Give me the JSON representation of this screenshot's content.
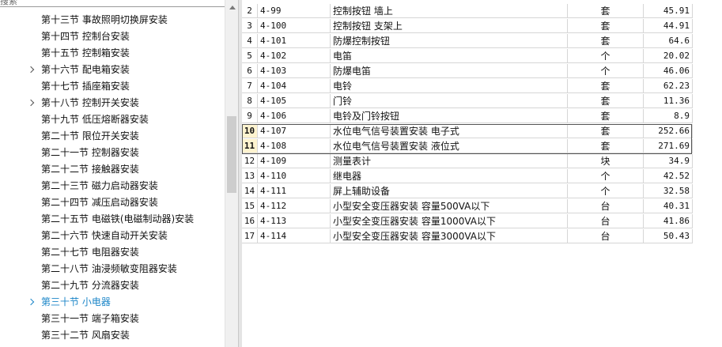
{
  "tree": {
    "search_partial": "搜索",
    "items": [
      {
        "label": "第十三节  事故照明切换屏安装",
        "expandable": false
      },
      {
        "label": "第十四节  控制台安装",
        "expandable": false
      },
      {
        "label": "第十五节  控制箱安装",
        "expandable": false
      },
      {
        "label": "第十六节  配电箱安装",
        "expandable": true
      },
      {
        "label": "第十七节  插座箱安装",
        "expandable": false
      },
      {
        "label": "第十八节  控制开关安装",
        "expandable": true
      },
      {
        "label": "第十九节  低压熔断器安装",
        "expandable": false
      },
      {
        "label": "第二十节  限位开关安装",
        "expandable": false
      },
      {
        "label": "第二十一节  控制器安装",
        "expandable": false
      },
      {
        "label": "第二十二节  接触器安装",
        "expandable": false
      },
      {
        "label": "第二十三节  磁力启动器安装",
        "expandable": false
      },
      {
        "label": "第二十四节  减压启动器安装",
        "expandable": false
      },
      {
        "label": "第二十五节  电磁铁(电磁制动器)安装",
        "expandable": false
      },
      {
        "label": "第二十六节  快速自动开关安装",
        "expandable": false
      },
      {
        "label": "第二十七节  电阻器安装",
        "expandable": false
      },
      {
        "label": "第二十八节  油浸频敏变阻器安装",
        "expandable": false
      },
      {
        "label": "第二十九节  分流器安装",
        "expandable": false
      },
      {
        "label": "第三十节  小电器",
        "expandable": true,
        "selected": true
      },
      {
        "label": "第三十一节  端子箱安装",
        "expandable": false
      },
      {
        "label": "第三十二节  风扇安装",
        "expandable": false
      }
    ]
  },
  "grid": {
    "rows": [
      {
        "idx": "2",
        "code": "4-99",
        "name": "控制按钮 墙上",
        "unit": "套",
        "price": "45.91"
      },
      {
        "idx": "3",
        "code": "4-100",
        "name": "控制按钮 支架上",
        "unit": "套",
        "price": "44.91"
      },
      {
        "idx": "4",
        "code": "4-101",
        "name": "防爆控制按钮",
        "unit": "套",
        "price": "64.6"
      },
      {
        "idx": "5",
        "code": "4-102",
        "name": "电笛",
        "unit": "个",
        "price": "20.02"
      },
      {
        "idx": "6",
        "code": "4-103",
        "name": "防爆电笛",
        "unit": "个",
        "price": "46.06"
      },
      {
        "idx": "7",
        "code": "4-104",
        "name": "电铃",
        "unit": "套",
        "price": "62.23"
      },
      {
        "idx": "8",
        "code": "4-105",
        "name": "门铃",
        "unit": "套",
        "price": "11.36"
      },
      {
        "idx": "9",
        "code": "4-106",
        "name": "电铃及门铃按钮",
        "unit": "套",
        "price": "8.9"
      },
      {
        "idx": "10",
        "code": "4-107",
        "name": "水位电气信号装置安装 电子式",
        "unit": "套",
        "price": "252.66",
        "highlight": true
      },
      {
        "idx": "11",
        "code": "4-108",
        "name": "水位电气信号装置安装 液位式",
        "unit": "套",
        "price": "271.69",
        "highlight": true
      },
      {
        "idx": "12",
        "code": "4-109",
        "name": "测量表计",
        "unit": "块",
        "price": "34.9"
      },
      {
        "idx": "13",
        "code": "4-110",
        "name": "继电器",
        "unit": "个",
        "price": "42.52"
      },
      {
        "idx": "14",
        "code": "4-111",
        "name": "屏上辅助设备",
        "unit": "个",
        "price": "32.58"
      },
      {
        "idx": "15",
        "code": "4-112",
        "name": "小型安全变压器安装 容量500VA以下",
        "unit": "台",
        "price": "40.31"
      },
      {
        "idx": "16",
        "code": "4-113",
        "name": "小型安全变压器安装 容量1000VA以下",
        "unit": "台",
        "price": "41.86"
      },
      {
        "idx": "17",
        "code": "4-114",
        "name": "小型安全变压器安装 容量3000VA以下",
        "unit": "台",
        "price": "50.43"
      }
    ]
  },
  "colors": {
    "selected_tree_text": "#1c86c8",
    "highlight_index_bg": "#fdf3cf"
  }
}
